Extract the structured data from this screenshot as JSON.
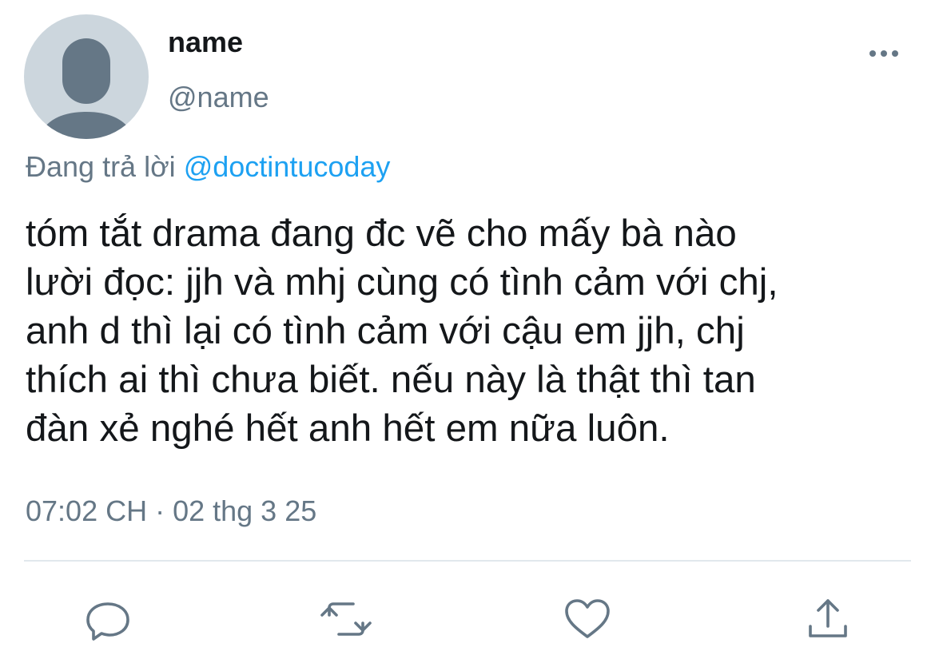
{
  "tweet": {
    "author": {
      "display_name": "name",
      "handle": "@name",
      "avatar_icon": "default-profile-icon"
    },
    "reply_to": {
      "prefix": "Đang trả lời",
      "mention": "@doctintucoday"
    },
    "text": "tóm tắt drama đang đc vẽ cho mấy bà nào\nlười đọc: jjh và mhj cùng có tình cảm với chj,\nanh d thì lại có tình cảm với cậu em jjh, chj\nthích ai thì chưa biết. nếu này là thật thì tan\nđàn xẻ nghé hết anh hết em nữa luôn.",
    "timestamp": "07:02 CH · 02 thg 3 25"
  },
  "actions": {
    "more_icon": "more-horizontal-icon",
    "reply_icon": "reply-icon",
    "retweet_icon": "retweet-icon",
    "like_icon": "heart-icon",
    "share_icon": "share-icon"
  },
  "colors": {
    "icon_gray": "#657786",
    "link_blue": "#1da1f2",
    "avatar_bg": "#ccd6dd",
    "avatar_figure": "#657786",
    "divider": "#e1e8ed"
  }
}
